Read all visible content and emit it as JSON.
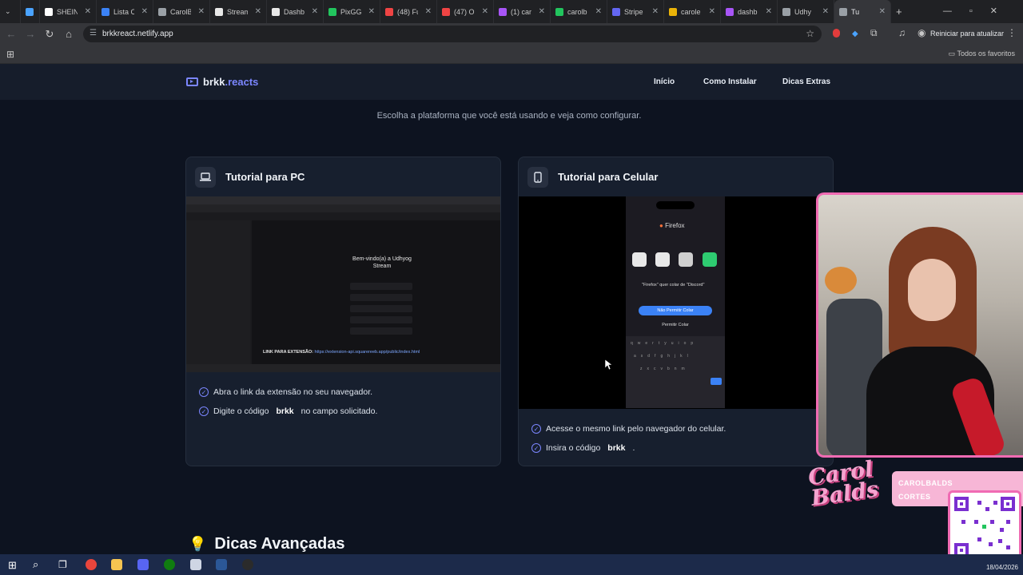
{
  "browser": {
    "tabs": [
      {
        "label": "",
        "color": "#4aa3ff"
      },
      {
        "label": "SHEIN",
        "color": "#ffffff"
      },
      {
        "label": "Lista C",
        "color": "#3b82f6"
      },
      {
        "label": "CarolB",
        "color": "#9aa0a6"
      },
      {
        "label": "Stream",
        "color": "#e8e8e8"
      },
      {
        "label": "Dashb",
        "color": "#e8e8e8"
      },
      {
        "label": "PixGG",
        "color": "#22c55e"
      },
      {
        "label": "(48) Fu",
        "color": "#ef4444"
      },
      {
        "label": "(47) O",
        "color": "#ef4444"
      },
      {
        "label": "(1) car",
        "color": "#a855f7"
      },
      {
        "label": "carolb",
        "color": "#22c55e"
      },
      {
        "label": "Stripe",
        "color": "#6366f1"
      },
      {
        "label": "carole",
        "color": "#eab308"
      },
      {
        "label": "dashb",
        "color": "#a855f7"
      },
      {
        "label": "Udhy",
        "color": "#9aa0a6"
      },
      {
        "label": "Tu",
        "color": "#9aa0a6"
      }
    ],
    "url": "brkkreact.netlify.app",
    "restart_label": "Reiniciar para atualizar",
    "favorites_label": "Todos os favoritos"
  },
  "site": {
    "brand_main": "brkk",
    "brand_accent": ".reacts",
    "menu": [
      "Início",
      "Como Instalar",
      "Dicas Extras"
    ],
    "subtitle": "Escolha a plataforma que você está usando e veja como configurar.",
    "pc_card": {
      "title": "Tutorial para PC",
      "steps": [
        {
          "pre": "Abra o link da extensão no seu navegador.",
          "code": "",
          "post": ""
        },
        {
          "pre": "Digite o código",
          "code": "brkk",
          "post": "no campo solicitado."
        }
      ],
      "shot": {
        "welcome": "Bem-vindo(a) a Udhyog Stream",
        "link_label": "LINK PARA EXTENSÃO:",
        "link_url": "https://extension-api.squarereeb.app/public/index.html"
      }
    },
    "mobile_card": {
      "title": "Tutorial para Celular",
      "steps": [
        {
          "pre": "Acesse o mesmo link pelo navegador do celular.",
          "code": "",
          "post": ""
        },
        {
          "pre": "Insira o código",
          "code": "brkk",
          "post": "."
        }
      ],
      "shot": {
        "browser": "Firefox",
        "prompt": "\"Firefox\" quer colar de \"Discord\"",
        "deny": "Não Permitir Colar",
        "allow": "Permitir Colar"
      }
    },
    "advanced_title": "Dicas Avançadas"
  },
  "overlay": {
    "logo_text": "Carol Balds",
    "handle": "CAROLBALDS",
    "handle2": "CORTES"
  },
  "taskbar": {
    "date": "18/04/2026"
  }
}
